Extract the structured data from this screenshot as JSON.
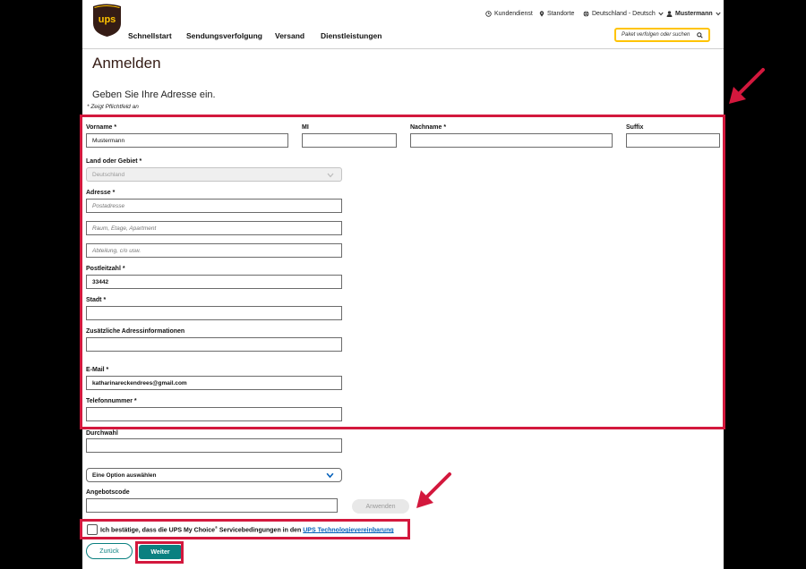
{
  "header": {
    "logo_text": "ups",
    "utility": {
      "customer_service": "Kundendienst",
      "locations": "Standorte",
      "language": "Deutschland - Deutsch",
      "user": "Mustermann"
    },
    "nav": [
      "Schnellstart",
      "Sendungsverfolgung",
      "Versand",
      "Dienstleistungen"
    ],
    "search_placeholder": "Paket verfolgen oder suchen"
  },
  "page": {
    "title": "Anmelden",
    "subtitle": "Geben Sie Ihre Adresse ein.",
    "required_note": "* Zeigt Pflichtfeld an"
  },
  "form": {
    "first_name": {
      "label": "Vorname *",
      "value": "Mustermann"
    },
    "middle_initial": {
      "label": "MI",
      "value": ""
    },
    "last_name": {
      "label": "Nachname *",
      "value": ""
    },
    "suffix": {
      "label": "Suffix",
      "value": ""
    },
    "country": {
      "label": "Land oder Gebiet *",
      "value": "Deutschland"
    },
    "address": {
      "label": "Adresse *",
      "line1_placeholder": "Postadresse",
      "line2_placeholder": "Raum, Etage, Apartment",
      "line3_placeholder": "Abteilung, c/o usw."
    },
    "postal_code": {
      "label": "Postleitzahl *",
      "value": "33442"
    },
    "city": {
      "label": "Stadt *",
      "value": ""
    },
    "additional_info": {
      "label": "Zusätzliche Adressinformationen",
      "value": ""
    },
    "email": {
      "label": "E-Mail *",
      "value": "katharinareckendrees@gmail.com"
    },
    "phone": {
      "label": "Telefonnummer *",
      "value": ""
    },
    "extension": {
      "label": "Durchwahl",
      "value": ""
    },
    "option_select": {
      "value": "Eine Option auswählen"
    },
    "promo_code": {
      "label": "Angebotscode",
      "value": "",
      "apply_label": "Anwenden"
    },
    "consent": {
      "text": "Ich bestätige, dass die UPS My Choice",
      "sup": "®",
      "text2": " Servicebedingungen in den ",
      "link": "UPS Technologievereinbarung"
    },
    "back_label": "Zurück",
    "next_label": "Weiter"
  },
  "colors": {
    "annotation": "#d3183d",
    "ups_brown": "#351c15",
    "ups_gold": "#ffc400",
    "teal": "#0a8080"
  },
  "icons": [
    "clock-icon",
    "location-pin-icon",
    "globe-icon",
    "user-icon",
    "search-icon",
    "chevron-down-icon",
    "arrow-annotation-icon"
  ]
}
